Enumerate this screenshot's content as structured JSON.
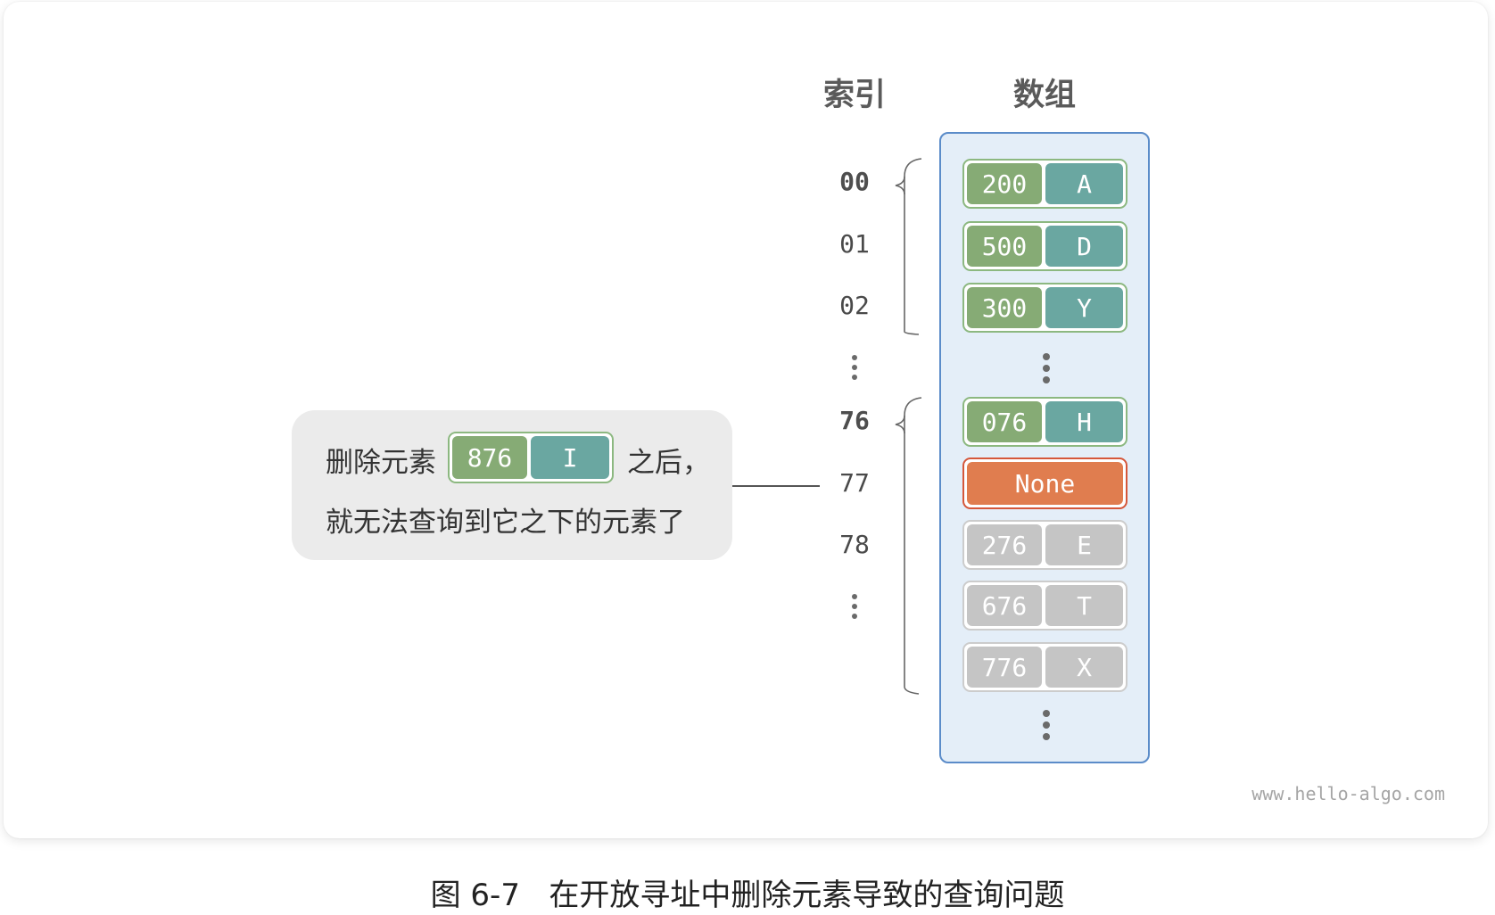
{
  "headers": {
    "index": "索引",
    "array": "数组"
  },
  "indices": [
    {
      "label": "00",
      "bold": true
    },
    {
      "label": "01",
      "bold": false
    },
    {
      "label": "02",
      "bold": false
    },
    {
      "label": "76",
      "bold": true
    },
    {
      "label": "77",
      "bold": false
    },
    {
      "label": "78",
      "bold": false
    }
  ],
  "buckets": [
    {
      "key": "200",
      "value": "A",
      "state": "active"
    },
    {
      "key": "500",
      "value": "D",
      "state": "active"
    },
    {
      "key": "300",
      "value": "Y",
      "state": "active"
    },
    {
      "key": "076",
      "value": "H",
      "state": "active"
    },
    {
      "key": "",
      "value": "None",
      "state": "deleted"
    },
    {
      "key": "276",
      "value": "E",
      "state": "unreachable"
    },
    {
      "key": "676",
      "value": "T",
      "state": "unreachable"
    },
    {
      "key": "776",
      "value": "X",
      "state": "unreachable"
    }
  ],
  "callout": {
    "prefix": "删除元素",
    "removed_key": "876",
    "removed_value": "I",
    "suffix": "之后，",
    "line2": "就无法查询到它之下的元素了"
  },
  "colors": {
    "key_fill": "#86ab75",
    "value_fill": "#6aa7a1",
    "none_fill": "#e07d4f",
    "grey_fill": "#c5c5c5",
    "array_bg": "#e4eef8",
    "array_border": "#5b8cc9"
  },
  "watermark": "www.hello-algo.com",
  "caption": "图 6-7   在开放寻址中删除元素导致的查询问题"
}
